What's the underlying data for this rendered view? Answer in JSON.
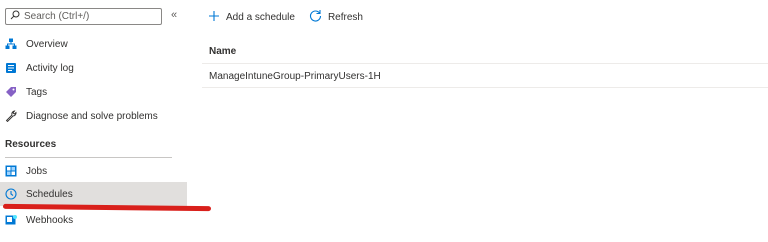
{
  "sidebar": {
    "search_placeholder": "Search (Ctrl+/)",
    "collapse_glyph": "«",
    "items": [
      {
        "label": "Overview",
        "icon": "overview-icon"
      },
      {
        "label": "Activity log",
        "icon": "activity-log-icon"
      },
      {
        "label": "Tags",
        "icon": "tag-icon"
      },
      {
        "label": "Diagnose and solve problems",
        "icon": "wrench-icon"
      }
    ],
    "section_title": "Resources",
    "resource_items": [
      {
        "label": "Jobs",
        "icon": "jobs-icon"
      },
      {
        "label": "Schedules",
        "icon": "clock-icon",
        "selected": true
      },
      {
        "label": "Webhooks",
        "icon": "webhook-icon"
      }
    ]
  },
  "toolbar": {
    "add_label": "Add a schedule",
    "refresh_label": "Refresh"
  },
  "grid": {
    "columns": [
      "Name"
    ],
    "rows": [
      {
        "name": "ManageIntuneGroup-PrimaryUsers-1H"
      }
    ]
  },
  "colors": {
    "accent": "#0078d4",
    "selected_bg": "#e1dfdd",
    "annotation_red": "#d9201b"
  }
}
